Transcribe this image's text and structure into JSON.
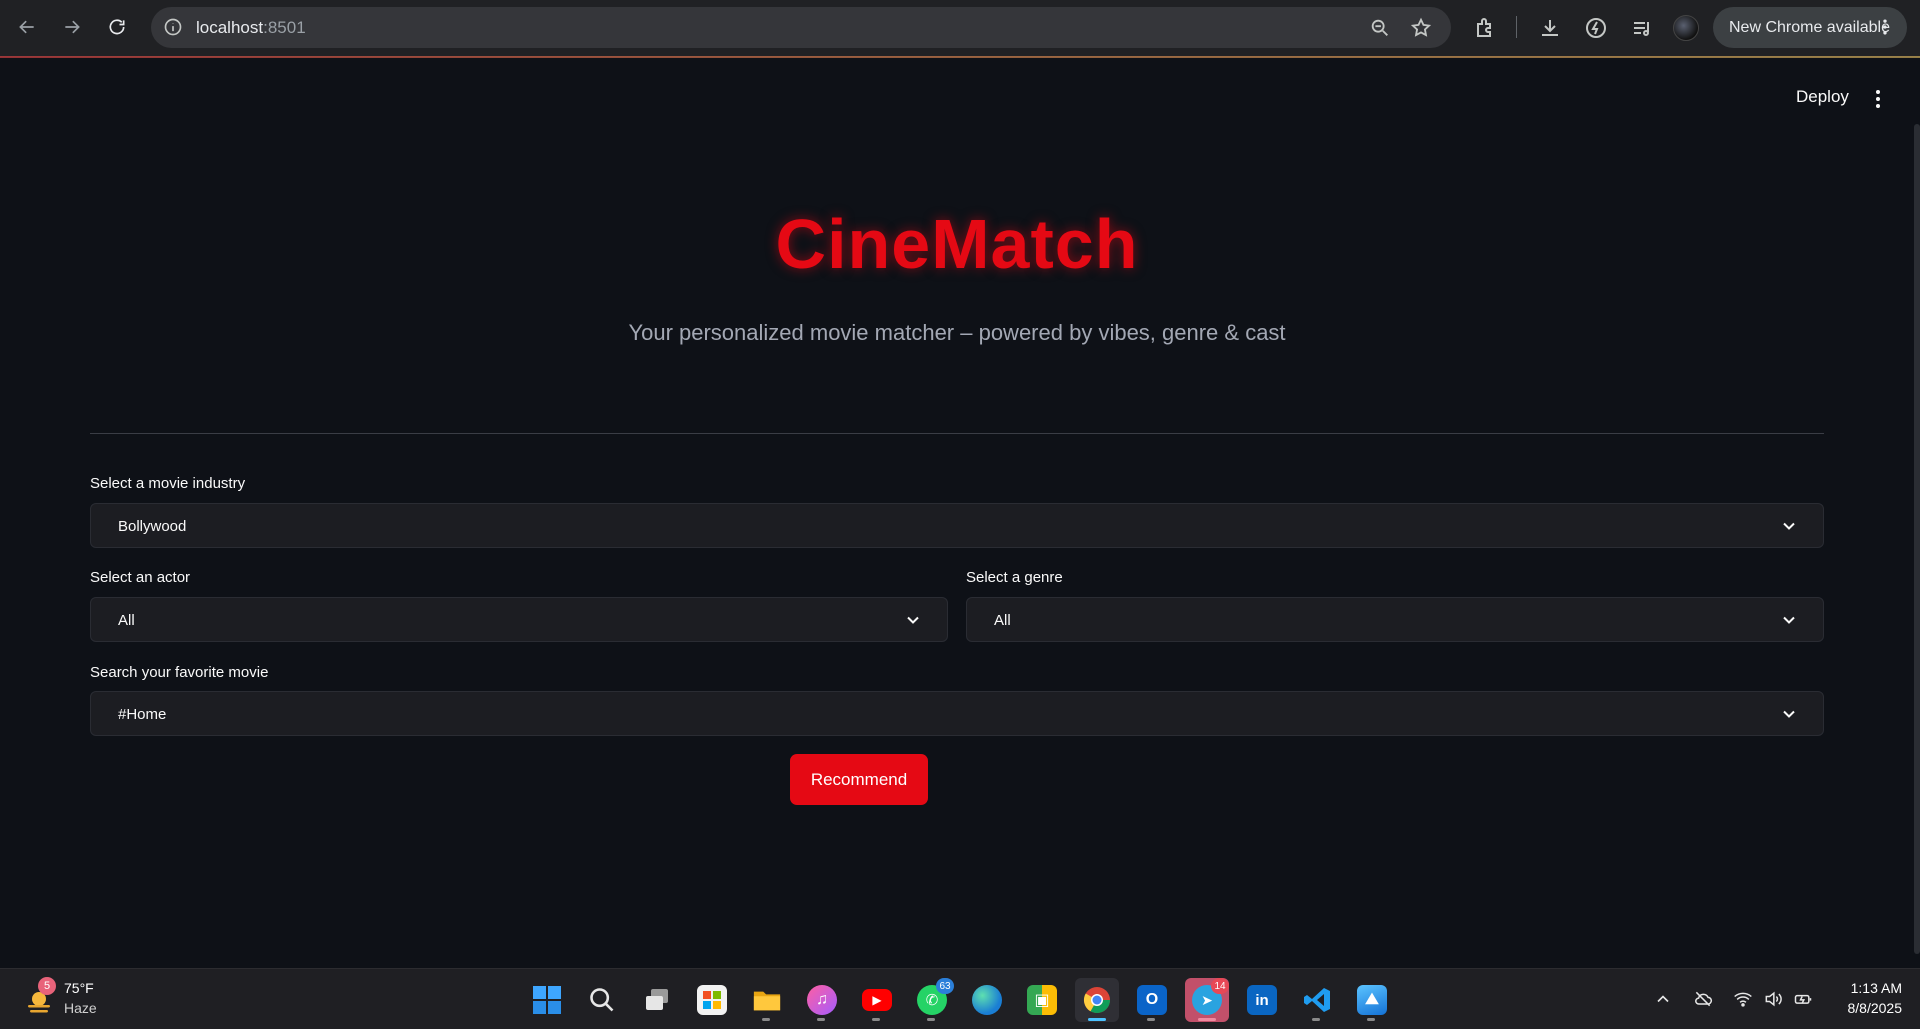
{
  "browser": {
    "url_host": "localhost",
    "url_port": ":8501",
    "update_label": "New Chrome available"
  },
  "app": {
    "deploy_label": "Deploy",
    "title": "CineMatch",
    "subtitle": "Your personalized movie matcher – powered by vibes, genre & cast",
    "industry": {
      "label": "Select a movie industry",
      "value": "Bollywood"
    },
    "actor": {
      "label": "Select an actor",
      "value": "All"
    },
    "genre": {
      "label": "Select a genre",
      "value": "All"
    },
    "movie": {
      "label": "Search your favorite movie",
      "value": "#Home"
    },
    "recommend_label": "Recommend",
    "accent_color": "#e50914"
  },
  "taskbar": {
    "weather": {
      "temp": "75°F",
      "condition": "Haze",
      "badge": "5"
    },
    "apps": [
      {
        "name": "start",
        "badge": ""
      },
      {
        "name": "search",
        "badge": ""
      },
      {
        "name": "task-view",
        "badge": ""
      },
      {
        "name": "microsoft-store",
        "badge": ""
      },
      {
        "name": "file-explorer",
        "badge": ""
      },
      {
        "name": "itunes",
        "badge": ""
      },
      {
        "name": "youtube",
        "badge": ""
      },
      {
        "name": "whatsapp",
        "badge": "63"
      },
      {
        "name": "edge",
        "badge": ""
      },
      {
        "name": "meet",
        "badge": ""
      },
      {
        "name": "chrome",
        "badge": ""
      },
      {
        "name": "outlook",
        "badge": ""
      },
      {
        "name": "telegram",
        "badge": "14"
      },
      {
        "name": "linkedin",
        "badge": ""
      },
      {
        "name": "vscode",
        "badge": ""
      },
      {
        "name": "photos",
        "badge": ""
      }
    ],
    "clock": {
      "time": "1:13 AM",
      "date": "8/8/2025"
    }
  }
}
